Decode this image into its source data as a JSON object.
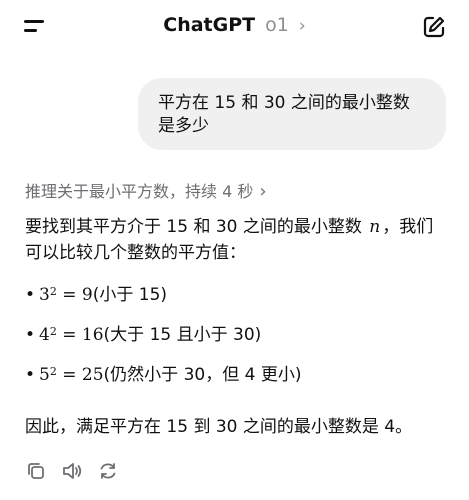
{
  "header": {
    "title": "ChatGPT",
    "model": "o1",
    "model_chevron": "›"
  },
  "user_message": "平方在 15 和 30 之间的最小整数是多少",
  "reasoning": {
    "label": "推理关于最小平方数，持续 4 秒",
    "chevron": "›"
  },
  "answer": {
    "intro_part1": "要找到其平方介于 15 和 30 之间的最小整数",
    "intro_var": "n",
    "intro_part2": "，我们可以比较几个整数的平方值：",
    "bullets": [
      {
        "base": "3",
        "exp": "2",
        "eq": " = ",
        "result": "9",
        "note": "(小于 15)"
      },
      {
        "base": "4",
        "exp": "2",
        "eq": " = ",
        "result": "16",
        "note": "(大于 15 且小于 30)"
      },
      {
        "base": "5",
        "exp": "2",
        "eq": " = ",
        "result": "25",
        "note": "(仍然小于 30，但 4 更小)"
      }
    ],
    "bullet_glyph": "•",
    "conclusion": "因此，满足平方在 15 到 30 之间的最小整数是 4。"
  },
  "actions": {
    "icons": [
      "copy-icon",
      "speaker-icon",
      "regenerate-icon"
    ]
  },
  "colors": {
    "bubble_bg": "#f0f0f0",
    "muted_text": "#6e6e73",
    "text": "#111111"
  }
}
